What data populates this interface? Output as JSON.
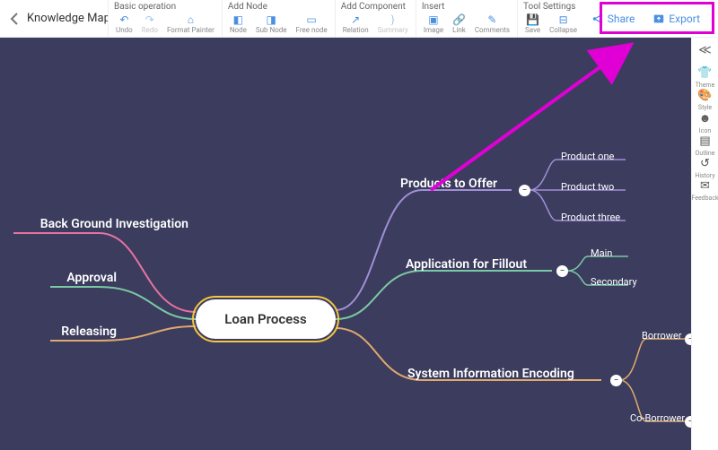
{
  "title": "Knowledge Map",
  "toolbar": {
    "groups": [
      {
        "title": "Basic operation",
        "items": [
          {
            "name": "undo",
            "label": "Undo",
            "icon": "↶",
            "color": "#4a90e2"
          },
          {
            "name": "redo",
            "label": "Redo",
            "icon": "↷",
            "color": "#4a90e2",
            "muted": true
          },
          {
            "name": "format-painter",
            "label": "Format Painter",
            "icon": "⌂",
            "color": "#4a90e2"
          }
        ]
      },
      {
        "title": "Add Node",
        "items": [
          {
            "name": "node",
            "label": "Node",
            "icon": "◧",
            "color": "#4a90e2"
          },
          {
            "name": "sub-node",
            "label": "Sub Node",
            "icon": "◨",
            "color": "#4a90e2"
          },
          {
            "name": "free-node",
            "label": "Free node",
            "icon": "▭",
            "color": "#4a90e2"
          }
        ]
      },
      {
        "title": "Add Component",
        "items": [
          {
            "name": "relation",
            "label": "Relation",
            "icon": "↗",
            "color": "#4a90e2"
          },
          {
            "name": "summary",
            "label": "Summary",
            "icon": "}",
            "color": "#4a90e2",
            "muted": true
          }
        ]
      },
      {
        "title": "Insert",
        "items": [
          {
            "name": "image",
            "label": "Image",
            "icon": "▣",
            "color": "#4a90e2"
          },
          {
            "name": "link",
            "label": "Link",
            "icon": "🔗",
            "color": "#4a90e2"
          },
          {
            "name": "comments",
            "label": "Comments",
            "icon": "✎",
            "color": "#4a90e2"
          }
        ]
      },
      {
        "title": "Tool Settings",
        "items": [
          {
            "name": "save",
            "label": "Save",
            "icon": "💾",
            "color": "#4a90e2"
          },
          {
            "name": "collapse",
            "label": "Collapse",
            "icon": "⊟",
            "color": "#4a90e2"
          }
        ]
      }
    ],
    "share": "Share",
    "export": "Export"
  },
  "sidebar": [
    {
      "name": "theme",
      "label": "Theme",
      "icon": "👕"
    },
    {
      "name": "style",
      "label": "Style",
      "icon": "🎨"
    },
    {
      "name": "icon",
      "label": "Icon",
      "icon": "☻"
    },
    {
      "name": "outline",
      "label": "Outline",
      "icon": "▤"
    },
    {
      "name": "history",
      "label": "History",
      "icon": "↺"
    },
    {
      "name": "feedback",
      "label": "Feedback",
      "icon": "✉"
    }
  ],
  "mindmap": {
    "center": "Loan Process",
    "left": [
      {
        "label": "Back Ground Investigation",
        "color": "#e6739f"
      },
      {
        "label": "Approval",
        "color": "#7bc8a4"
      },
      {
        "label": "Releasing",
        "color": "#e0a96d"
      }
    ],
    "right": [
      {
        "label": "Products to Offer",
        "color": "#a18fd6",
        "children": [
          "Product one",
          "Product two",
          "Product three"
        ]
      },
      {
        "label": "Application for Fillout",
        "color": "#7bc8a4",
        "children": [
          "Main",
          "Secondary"
        ]
      },
      {
        "label": "System Information Encoding",
        "color": "#e0a96d",
        "children": [
          "Borrower",
          "Co-Borrower"
        ]
      }
    ]
  }
}
